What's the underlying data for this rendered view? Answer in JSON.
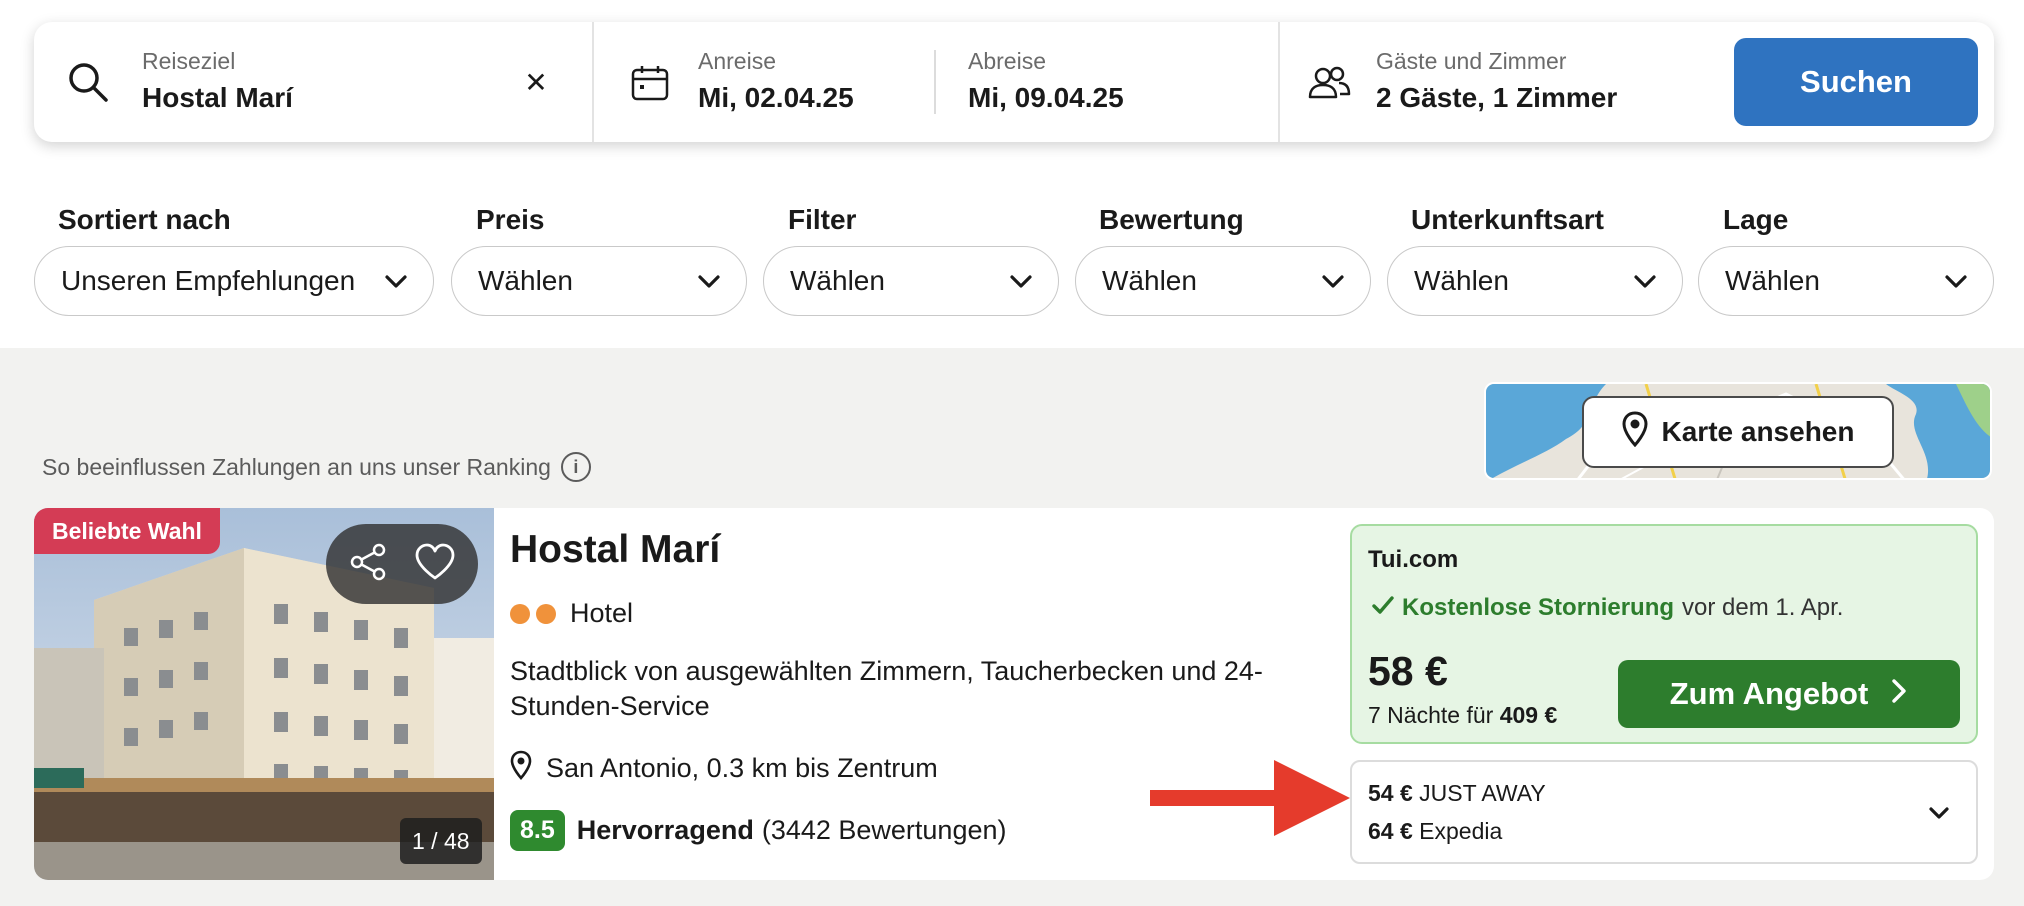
{
  "search": {
    "destination_label": "Reiseziel",
    "destination_value": "Hostal Marí",
    "clear_symbol": "✕",
    "checkin_label": "Anreise",
    "checkin_value": "Mi, 02.04.25",
    "checkout_label": "Abreise",
    "checkout_value": "Mi, 09.04.25",
    "guests_label": "Gäste und Zimmer",
    "guests_value": "2 Gäste, 1 Zimmer",
    "search_button": "Suchen"
  },
  "filters": [
    {
      "label": "Sortiert nach",
      "value": "Unseren Empfehlungen"
    },
    {
      "label": "Preis",
      "value": "Wählen"
    },
    {
      "label": "Filter",
      "value": "Wählen"
    },
    {
      "label": "Bewertung",
      "value": "Wählen"
    },
    {
      "label": "Unterkunftsart",
      "value": "Wählen"
    },
    {
      "label": "Lage",
      "value": "Wählen"
    }
  ],
  "ranking_note": "So beeinflussen Zahlungen an uns unser Ranking",
  "ranking_info_symbol": "i",
  "map": {
    "button": "Karte ansehen"
  },
  "result": {
    "badge": "Beliebte Wahl",
    "photo_counter": "1 / 48",
    "name": "Hostal Marí",
    "type": "Hotel",
    "stars": 2,
    "description": "Stadtblick von ausgewählten Zimmern, Taucherbecken und 24-Stunden-Service",
    "location": "San Antonio, 0.3 km bis Zentrum",
    "rating_score": "8.5",
    "rating_word": "Hervorragend",
    "rating_count": "(3442 Bewertungen)",
    "deal": {
      "provider": "Tui.com",
      "cancel_strong": "Kostenlose Stornierung",
      "cancel_rest": "vor dem 1. Apr.",
      "price": "58 €",
      "nights_text": "7 Nächte für",
      "nights_total": "409 €",
      "button": "Zum Angebot"
    },
    "other_offers": [
      {
        "price": "54 €",
        "provider": "JUST AWAY"
      },
      {
        "price": "64 €",
        "provider": "Expedia"
      }
    ]
  },
  "colors": {
    "search_button": "#2f73c0",
    "offer_button": "#2d7d2d",
    "deal_background": "#e6f5e4",
    "badge": "#d43c55",
    "arrow": "#e53b2c",
    "score": "#2f8a2f"
  }
}
